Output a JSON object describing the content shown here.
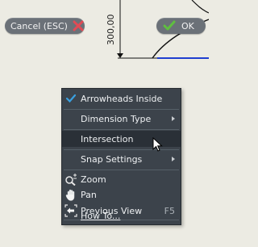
{
  "drawing": {
    "dimension_value": "300,00"
  },
  "buttons": {
    "cancel_label": "Cancel (ESC)",
    "ok_label": "OK"
  },
  "menu": {
    "items": [
      {
        "label": "Arrowheads Inside",
        "checked": true
      },
      {
        "label": "Dimension Type",
        "submenu": true
      },
      {
        "label": "Intersection",
        "highlighted": true
      },
      {
        "label": "Snap Settings",
        "submenu": true
      },
      {
        "label": "Zoom",
        "icon": "zoom-icon"
      },
      {
        "label": "Pan",
        "icon": "pan-hand-icon"
      },
      {
        "label": "Previous View",
        "icon": "previous-view-icon",
        "shortcut": "F5"
      },
      {
        "label": "How To..."
      }
    ]
  },
  "colors": {
    "background": "#ecebe3",
    "menu_bg": "#3c434b",
    "menu_highlight": "#2a3037",
    "pill_bg": "#6b7178",
    "cancel_icon": "#e24b55",
    "ok_icon": "#5fbf3f",
    "check": "#3aa0e0",
    "drawing_line": "#1f3fd0"
  }
}
